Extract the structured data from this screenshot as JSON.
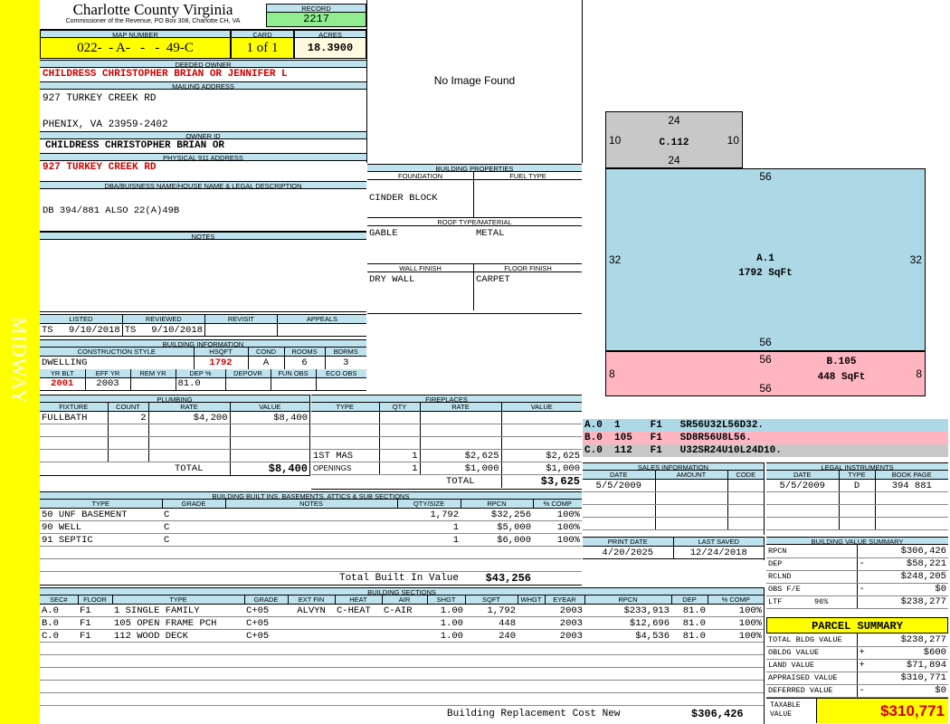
{
  "sidebar_label": "MIDWAY",
  "county": "Charlotte County Virginia",
  "commissioner": "Commissioner of the Revenue, PO Box 308, Charlotte CH, VA",
  "record": {
    "label": "RECORD",
    "value": "2217"
  },
  "map": {
    "label": "MAP NUMBER",
    "value": "022-  - A-   -   -  49-C"
  },
  "card": {
    "label": "CARD",
    "value": "1 of 1"
  },
  "acres": {
    "label": "ACRES",
    "value": "18.3900"
  },
  "deeded_owner": {
    "label": "DEEDED OWNER",
    "value": "CHILDRESS CHRISTOPHER BRIAN OR JENNIFER L"
  },
  "mailing": {
    "label": "MAILING ADDRESS",
    "line1": "927 TURKEY CREEK RD",
    "line2": "PHENIX, VA 23959-2402"
  },
  "owner_id": {
    "label": "OWNER ID",
    "value": "CHILDRESS CHRISTOPHER BRIAN OR"
  },
  "physical": {
    "label": "PHYSICAL 911 ADDRESS",
    "value": "927 TURKEY CREEK RD"
  },
  "legal": {
    "label": "DBA/BUISNESS NAME/HOUSE NAME & LEGAL DESCRIPTION",
    "value": "DB 394/881 ALSO 22(A)49B"
  },
  "notes": {
    "label": "NOTES"
  },
  "listing": {
    "listed_label": "LISTED",
    "reviewed_label": "REVIEWED",
    "revisit_label": "REVISIT",
    "appeals_label": "APPEALS",
    "listed_by": "TS",
    "listed_date": "9/10/2018",
    "reviewed_by": "TS",
    "reviewed_date": "9/10/2018"
  },
  "building_info": {
    "title": "BUILDING INFORMATION",
    "h1": [
      "CONSTRUCTION STYLE",
      "HSQFT",
      "COND",
      "ROOMS",
      "BDRMS"
    ],
    "v1": [
      "DWELLING",
      "1792",
      "A",
      "6",
      "3"
    ],
    "h2": [
      "YR BLT",
      "EFF YR",
      "REM YR",
      "DEP %",
      "DEPOVR",
      "FUN OBS",
      "ECO OBS"
    ],
    "v2": [
      "2001",
      "2003",
      "",
      "81.0",
      "",
      "",
      ""
    ]
  },
  "photo": {
    "text": "No Image Found"
  },
  "bldg_props": {
    "title": "BUILDING PROPERTIES",
    "foundation_label": "FOUNDATION",
    "fuel_label": "FUEL TYPE",
    "foundation": "CINDER BLOCK",
    "fuel": "",
    "roof_label": "ROOF TYPE/MATERIAL",
    "roof_type": "GABLE",
    "roof_mat": "METAL",
    "wall_label": "WALL FINISH",
    "floor_label": "FLOOR FINISH",
    "wall": "DRY WALL",
    "floor": "CARPET"
  },
  "sketch": {
    "c_label": "C.112",
    "c_top": "24",
    "c_bottom": "24",
    "c_left": "10",
    "c_right": "10",
    "a_label": "A.1",
    "a_sqft": "1792 SqFt",
    "a_top": "56",
    "a_bottom": "56",
    "a_left": "32",
    "a_right": "32",
    "b_label": "B.105",
    "b_sqft": "448 SqFt",
    "b_top": "56",
    "b_bottom": "56",
    "b_left": "8",
    "b_right": "8",
    "colors": {
      "a": "#add8e6",
      "b": "#ffb6c1",
      "c": "#c8c8c8"
    }
  },
  "sketch_legend": [
    "A.0  1     F1   SR56U32L56D32.",
    "B.0  105   F1   SD8R56U8L56.",
    "C.0  112   F1   U32SR24U10L24D10."
  ],
  "plumbing": {
    "title": "PLUMBING",
    "headers": [
      "FIXTURE",
      "COUNT",
      "RATE",
      "VALUE"
    ],
    "rows": [
      [
        "FULLBATH",
        "2",
        "$4,200",
        "$8,400"
      ]
    ],
    "total_label": "TOTAL",
    "total": "$8,400"
  },
  "fireplaces": {
    "title": "FIREPLACES",
    "headers": [
      "TYPE",
      "QTY",
      "RATE",
      "VALUE"
    ],
    "rows": [
      [
        "1ST MAS",
        "1",
        "$2,625",
        "$2,625"
      ],
      [
        "OPENINGS",
        "1",
        "$1,000",
        "$1,000"
      ]
    ],
    "total_label": "TOTAL",
    "total": "$3,625"
  },
  "sales": {
    "title": "SALES INFORMATION",
    "headers": [
      "DATE",
      "AMOUNT",
      "CODE"
    ],
    "rows": [
      [
        "5/5/2009",
        "",
        ""
      ]
    ]
  },
  "legal_instr": {
    "title": "LEGAL INSTRUMENTS",
    "headers": [
      "DATE",
      "TYPE",
      "BOOK PAGE"
    ],
    "rows": [
      [
        "5/5/2009",
        "D",
        "394 881"
      ]
    ]
  },
  "print": {
    "print_label": "PRINT DATE",
    "saved_label": "LAST SAVED",
    "print_date": "4/20/2025",
    "saved_date": "12/24/2018"
  },
  "builtins": {
    "title": "BUILDING BUILT INS, BASEMENTS, ATTICS & SUB SECTIONS",
    "headers": [
      "TYPE",
      "GRADE",
      "NOTES",
      "QTY/SIZE",
      "RPCN",
      "% COMP"
    ],
    "rows": [
      [
        "50 UNF BASEMENT",
        "C",
        "",
        "1,792",
        "$32,256",
        "100%"
      ],
      [
        "90 WELL",
        "C",
        "",
        "1",
        "$5,000",
        "100%"
      ],
      [
        "91 SEPTIC",
        "C",
        "",
        "1",
        "$6,000",
        "100%"
      ]
    ],
    "total_label": "Total Built In Value",
    "total": "$43,256"
  },
  "bvs": {
    "title": "BUILDING VALUE SUMMARY",
    "rows": [
      [
        "RPCN",
        "",
        "$306,426"
      ],
      [
        "DEP",
        "-",
        "$58,221"
      ],
      [
        "RCLND",
        "",
        "$248,205"
      ],
      [
        "OBS F/E",
        "-",
        "$0"
      ],
      [
        "LTF       96%",
        "",
        "$238,277"
      ]
    ]
  },
  "parcel": {
    "title": "PARCEL SUMMARY",
    "rows": [
      [
        "TOTAL BLDG VALUE",
        "",
        "$238,277"
      ],
      [
        "OBLDG VALUE",
        "+",
        "$600"
      ],
      [
        "LAND VALUE",
        "+",
        "$71,894"
      ],
      [
        "APPRAISED VALUE",
        "",
        "$310,771"
      ],
      [
        "DEFERRED VALUE",
        "-",
        "$0"
      ]
    ],
    "taxable_label": "TAXABLE VALUE",
    "taxable": "$310,771"
  },
  "sections": {
    "title": "BUILDING SECTIONS",
    "headers": [
      "SEC#",
      "FLOOR",
      "TYPE",
      "GRADE",
      "EXT FIN",
      "HEAT",
      "AIR",
      "SHGT",
      "SQFT",
      "WHGT",
      "EYEAR",
      "RPCN",
      "DEP",
      "% COMP"
    ],
    "rows": [
      [
        "A.0",
        "F1",
        "1 SINGLE FAMILY",
        "C+05",
        "ALVYN",
        "C-HEAT",
        "C-AIR",
        "1.00",
        "1,792",
        "",
        "2003",
        "$233,913",
        "81.0",
        "100%"
      ],
      [
        "B.0",
        "F1",
        "105 OPEN FRAME PCH",
        "C+05",
        "",
        "",
        "",
        "1.00",
        "448",
        "",
        "2003",
        "$12,696",
        "81.0",
        "100%"
      ],
      [
        "C.0",
        "F1",
        "112 WOOD DECK",
        "C+05",
        "",
        "",
        "",
        "1.00",
        "240",
        "",
        "2003",
        "$4,536",
        "81.0",
        "100%"
      ]
    ],
    "total_label": "Building Replacement Cost New",
    "total": "$306,426"
  }
}
